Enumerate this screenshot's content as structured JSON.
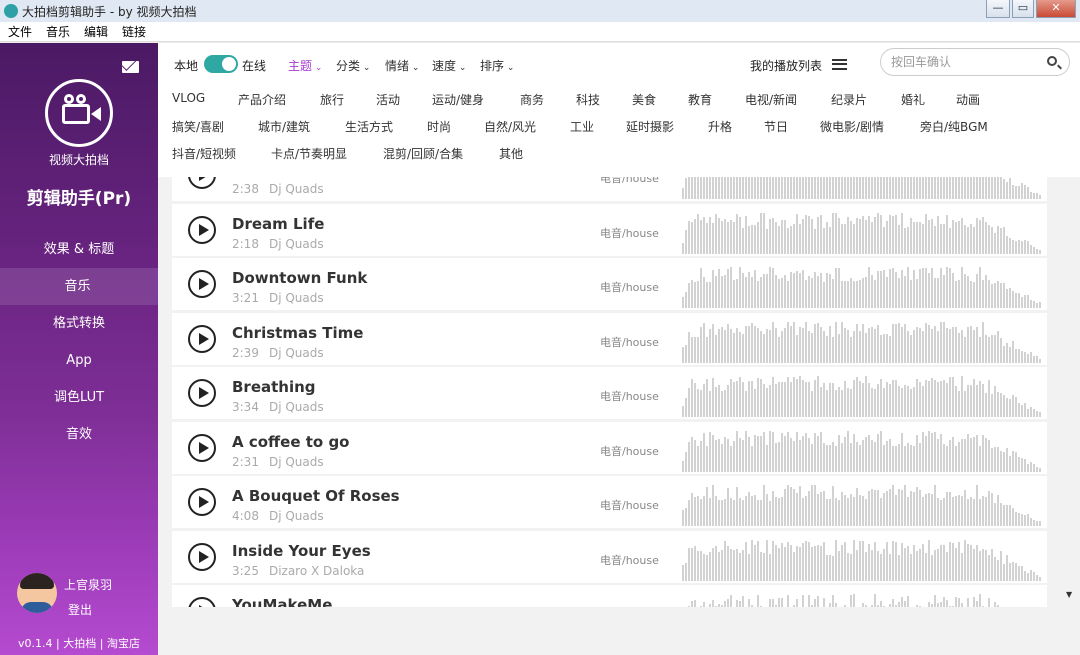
{
  "window": {
    "title": "大拍档剪辑助手 - by 视频大拍档",
    "controls": {
      "minimize": "—",
      "maximize": "▭",
      "close": "✕"
    }
  },
  "menu": [
    "文件",
    "音乐",
    "编辑",
    "链接"
  ],
  "sidebar": {
    "logo_label": "视频大拍档",
    "app_name": "剪辑助手(Pr)",
    "nav": [
      {
        "label": "效果 & 标题",
        "active": false
      },
      {
        "label": "音乐",
        "active": true
      },
      {
        "label": "格式转换",
        "active": false
      },
      {
        "label": "App",
        "active": false
      },
      {
        "label": "调色LUT",
        "active": false
      },
      {
        "label": "音效",
        "active": false
      }
    ],
    "user": {
      "name": "上官泉羽",
      "logout": "登出"
    },
    "footer": "v0.1.4 | 大拍档 | 淘宝店"
  },
  "toolbar": {
    "local_label": "本地",
    "online_label": "在线",
    "toggle_on": true,
    "filters": [
      {
        "label": "主题",
        "active": true
      },
      {
        "label": "分类",
        "active": false
      },
      {
        "label": "情绪",
        "active": false
      },
      {
        "label": "速度",
        "active": false
      },
      {
        "label": "排序",
        "active": false
      }
    ],
    "playlist_label": "我的播放列表",
    "search_placeholder": "按回车确认",
    "accent_color": "#a53bd0",
    "toggle_color": "#2fa8a4"
  },
  "categories": [
    [
      "VLOG",
      "产品介绍",
      "旅行",
      "活动",
      "运动/健身",
      "商务",
      "科技",
      "美食",
      "教育",
      "电视/新闻",
      "纪录片",
      "婚礼",
      "动画"
    ],
    [
      "搞笑/喜剧",
      "城市/建筑",
      "生活方式",
      "时尚",
      "自然/风光",
      "工业",
      "延时摄影",
      "升格",
      "节日",
      "微电影/剧情",
      "旁白/纯BGM"
    ],
    [
      "抖音/短视频",
      "卡点/节奏明显",
      "混剪/回顾/合集",
      "其他"
    ]
  ],
  "songs": [
    {
      "title": "",
      "duration": "2:38",
      "artist": "Dj Quads",
      "genre": "电音/house",
      "wave_seed": 1
    },
    {
      "title": "Dream Life",
      "duration": "2:18",
      "artist": "Dj Quads",
      "genre": "电音/house",
      "wave_seed": 2
    },
    {
      "title": "Downtown Funk",
      "duration": "3:21",
      "artist": "Dj Quads",
      "genre": "电音/house",
      "wave_seed": 3
    },
    {
      "title": "Christmas Time",
      "duration": "2:39",
      "artist": "Dj Quads",
      "genre": "电音/house",
      "wave_seed": 4
    },
    {
      "title": "Breathing",
      "duration": "3:34",
      "artist": "Dj Quads",
      "genre": "电音/house",
      "wave_seed": 5
    },
    {
      "title": "A coffee to go",
      "duration": "2:31",
      "artist": "Dj Quads",
      "genre": "电音/house",
      "wave_seed": 6
    },
    {
      "title": "A Bouquet Of Roses",
      "duration": "4:08",
      "artist": "Dj Quads",
      "genre": "电音/house",
      "wave_seed": 7
    },
    {
      "title": "Inside Your Eyes",
      "duration": "3:25",
      "artist": "Dizaro X Daloka",
      "genre": "电音/house",
      "wave_seed": 8
    },
    {
      "title": "YouMakeMe",
      "duration": "",
      "artist": "",
      "genre": "",
      "wave_seed": 9
    }
  ],
  "scroll_arrow": "▼"
}
